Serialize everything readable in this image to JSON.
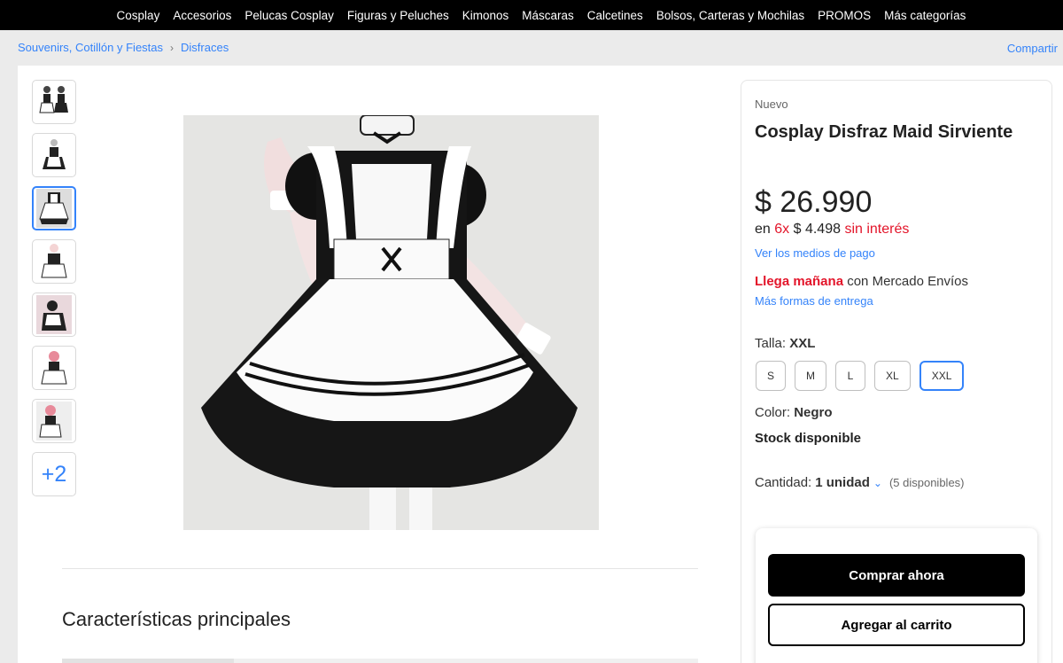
{
  "nav": {
    "items": [
      "Cosplay",
      "Accesorios",
      "Pelucas Cosplay",
      "Figuras y Peluches",
      "Kimonos",
      "Máscaras",
      "Calcetines",
      "Bolsos, Carteras y Mochilas",
      "PROMOS",
      "Más categorías"
    ]
  },
  "breadcrumb": {
    "items": [
      "Souvenirs, Cotillón y Fiestas",
      "Disfraces"
    ],
    "share": "Compartir"
  },
  "gallery": {
    "more_label": "+2",
    "active_index": 2
  },
  "product": {
    "condition": "Nuevo",
    "title": "Cosplay Disfraz Maid Sirviente",
    "price": "$ 26.990",
    "installments_prefix": "en",
    "installments_count": "6x",
    "installments_amount": "$ 4.498",
    "installments_suffix": "sin interés",
    "payment_link": "Ver los medios de pago",
    "shipping_bold": "Llega mañana",
    "shipping_rest": "con Mercado Envíos",
    "delivery_link": "Más formas de entrega"
  },
  "size": {
    "label": "Talla:",
    "selected": "XXL",
    "options": [
      "S",
      "M",
      "L",
      "XL",
      "XXL"
    ]
  },
  "color": {
    "label": "Color:",
    "value": "Negro"
  },
  "stock": "Stock disponible",
  "quantity": {
    "label": "Cantidad:",
    "value": "1 unidad",
    "available": "(5 disponibles)"
  },
  "actions": {
    "buy": "Comprar ahora",
    "cart": "Agregar al carrito"
  },
  "section": {
    "title": "Características principales"
  },
  "colors": {
    "accent": "#3483fa",
    "red": "#e3152a",
    "nav_bg": "#000000"
  }
}
